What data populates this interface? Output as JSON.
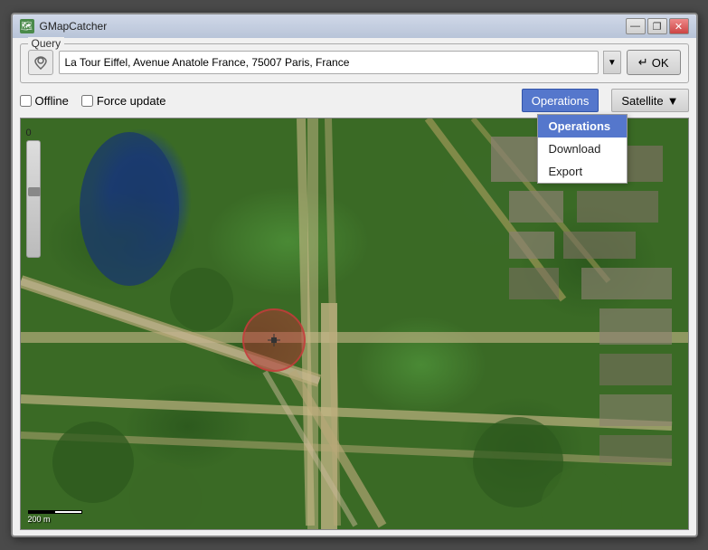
{
  "window": {
    "title": "GMapCatcher",
    "icon": "🗺"
  },
  "titlebar_controls": {
    "minimize": "—",
    "restore": "❐",
    "close": "✕"
  },
  "query_group": {
    "legend": "Query",
    "search_value": "La Tour Eiffel, Avenue Anatole France, 75007 Paris, France",
    "search_placeholder": "Enter location...",
    "ok_label": "OK",
    "ok_icon": "↵"
  },
  "toolbar": {
    "offline_label": "Offline",
    "force_update_label": "Force update",
    "offline_checked": false,
    "force_update_checked": false,
    "operations_label": "Operations",
    "satellite_label": "Satellite",
    "satellite_arrow": "▼"
  },
  "operations_menu": {
    "visible": true,
    "header": "Operations",
    "items": [
      "Download",
      "Export"
    ]
  },
  "map": {
    "zoom_level": "0",
    "scale_label": "200 m"
  }
}
